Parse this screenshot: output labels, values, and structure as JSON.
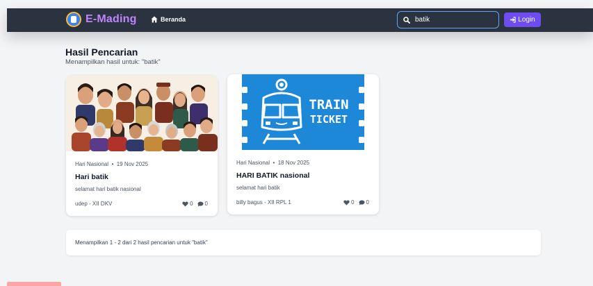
{
  "navbar": {
    "brand": "E-Mading",
    "nav_home": "Beranda",
    "search_value": "batik",
    "login": "Login"
  },
  "header": {
    "title": "Hasil Pencarian",
    "subtitle": "Menampilkan hasil untuk: \"batik\""
  },
  "results": [
    {
      "category": "Hari Nasional",
      "date": "19 Nov 2025",
      "title": "Hari batik",
      "excerpt": "selamat hari batik nasional",
      "author": "udep - XII DKV",
      "likes": "0",
      "comments": "0",
      "image": "illustration-people-in-batik"
    },
    {
      "category": "Hari Nasional",
      "date": "18 Nov 2025",
      "title": "HARI BATIK nasional",
      "excerpt": "selamat hari batik",
      "author": "billy bagus - XII RPL 1",
      "likes": "0",
      "comments": "0",
      "image": "train-ticket",
      "image_text": [
        "TRAIN",
        "TICKET"
      ]
    }
  ],
  "pagination_info": "Menampilkan 1 - 2 dari 2 hasil pencarian untuk \"batik\"",
  "colors": {
    "navbar": "#2b3240",
    "brand": "#c084fc",
    "login": "#6d4cf2",
    "ticket_blue": "#1e88d8"
  }
}
